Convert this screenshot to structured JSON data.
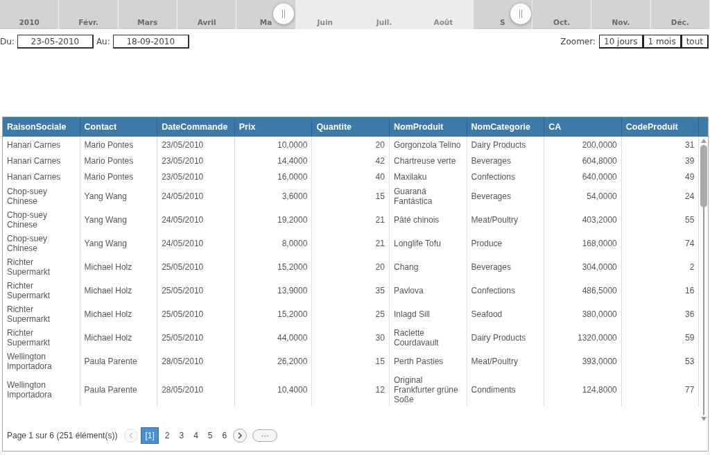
{
  "timeline": {
    "months": [
      {
        "label": "2010",
        "selected": false
      },
      {
        "label": "Févr.",
        "selected": false
      },
      {
        "label": "Mars",
        "selected": false
      },
      {
        "label": "Avril",
        "selected": false
      },
      {
        "label": "Ma",
        "selected": false
      },
      {
        "label": "Juin",
        "selected": true
      },
      {
        "label": "Juil.",
        "selected": true
      },
      {
        "label": "Août",
        "selected": true
      },
      {
        "label": "S",
        "selected": false
      },
      {
        "label": "Oct.",
        "selected": false
      },
      {
        "label": "Nov.",
        "selected": false
      },
      {
        "label": "Déc.",
        "selected": false
      }
    ]
  },
  "date_range": {
    "from_label": "Du:",
    "from": "23-05-2010",
    "to_label": "Au:",
    "to": "18-09-2010"
  },
  "zoom": {
    "label": "Zoomer:",
    "buttons": [
      "10 jours",
      "1 mois",
      "tout"
    ]
  },
  "table": {
    "columns": [
      {
        "label": "RaisonSociale",
        "kind": "text"
      },
      {
        "label": "Contact",
        "kind": "text"
      },
      {
        "label": "DateCommande",
        "kind": "text"
      },
      {
        "label": "Prix",
        "kind": "number"
      },
      {
        "label": "Quantite",
        "kind": "number"
      },
      {
        "label": "NomProduit",
        "kind": "text"
      },
      {
        "label": "NomCategorie",
        "kind": "text"
      },
      {
        "label": "CA",
        "kind": "number"
      },
      {
        "label": "CodeProduit",
        "kind": "number"
      }
    ],
    "rows": [
      [
        "Hanari Carnes",
        "Mario Pontes",
        "23/05/2010",
        "10,0000",
        "20",
        "Gorgonzola Telino",
        "Dairy Products",
        "200,0000",
        "31"
      ],
      [
        "Hanari Carnes",
        "Mario Pontes",
        "23/05/2010",
        "14,4000",
        "42",
        "Chartreuse verte",
        "Beverages",
        "604,8000",
        "39"
      ],
      [
        "Hanari Carnes",
        "Mario Pontes",
        "23/05/2010",
        "16,0000",
        "40",
        "Maxilaku",
        "Confections",
        "640,0000",
        "49"
      ],
      [
        "Chop-suey Chinese",
        "Yang Wang",
        "24/05/2010",
        "3,6000",
        "15",
        "Guaraná Fantástica",
        "Beverages",
        "54,0000",
        "24"
      ],
      [
        "Chop-suey Chinese",
        "Yang Wang",
        "24/05/2010",
        "19,2000",
        "21",
        "Pâté chinois",
        "Meat/Poultry",
        "403,2000",
        "55"
      ],
      [
        "Chop-suey Chinese",
        "Yang Wang",
        "24/05/2010",
        "8,0000",
        "21",
        "Longlife Tofu",
        "Produce",
        "168,0000",
        "74"
      ],
      [
        "Richter Supermarkt",
        "Michael Holz",
        "25/05/2010",
        "15,2000",
        "20",
        "Chang",
        "Beverages",
        "304,0000",
        "2"
      ],
      [
        "Richter Supermarkt",
        "Michael Holz",
        "25/05/2010",
        "13,9000",
        "35",
        "Pavlova",
        "Confections",
        "486,5000",
        "16"
      ],
      [
        "Richter Supermarkt",
        "Michael Holz",
        "25/05/2010",
        "15,2000",
        "25",
        "Inlagd Sill",
        "Seafood",
        "380,0000",
        "36"
      ],
      [
        "Richter Supermarkt",
        "Michael Holz",
        "25/05/2010",
        "44,0000",
        "30",
        "Raclette Courdavault",
        "Dairy Products",
        "1320,0000",
        "59"
      ],
      [
        "Wellington Importadora",
        "Paula Parente",
        "28/05/2010",
        "26,2000",
        "15",
        "Perth Pasties",
        "Meat/Poultry",
        "393,0000",
        "53"
      ],
      [
        "Wellington Importadora",
        "Paula Parente",
        "28/05/2010",
        "10,4000",
        "12",
        "Original Frankfurter grüne Soße",
        "Condiments",
        "124,8000",
        "77"
      ]
    ]
  },
  "pager": {
    "info": "Page 1 sur 6 (251 élément(s))",
    "prev_disabled": true,
    "pages": [
      {
        "label": "[1]",
        "selected": true
      },
      {
        "label": "2",
        "selected": false
      },
      {
        "label": "3",
        "selected": false
      },
      {
        "label": "4",
        "selected": false
      },
      {
        "label": "5",
        "selected": false
      },
      {
        "label": "6",
        "selected": false
      }
    ],
    "more": "···"
  }
}
